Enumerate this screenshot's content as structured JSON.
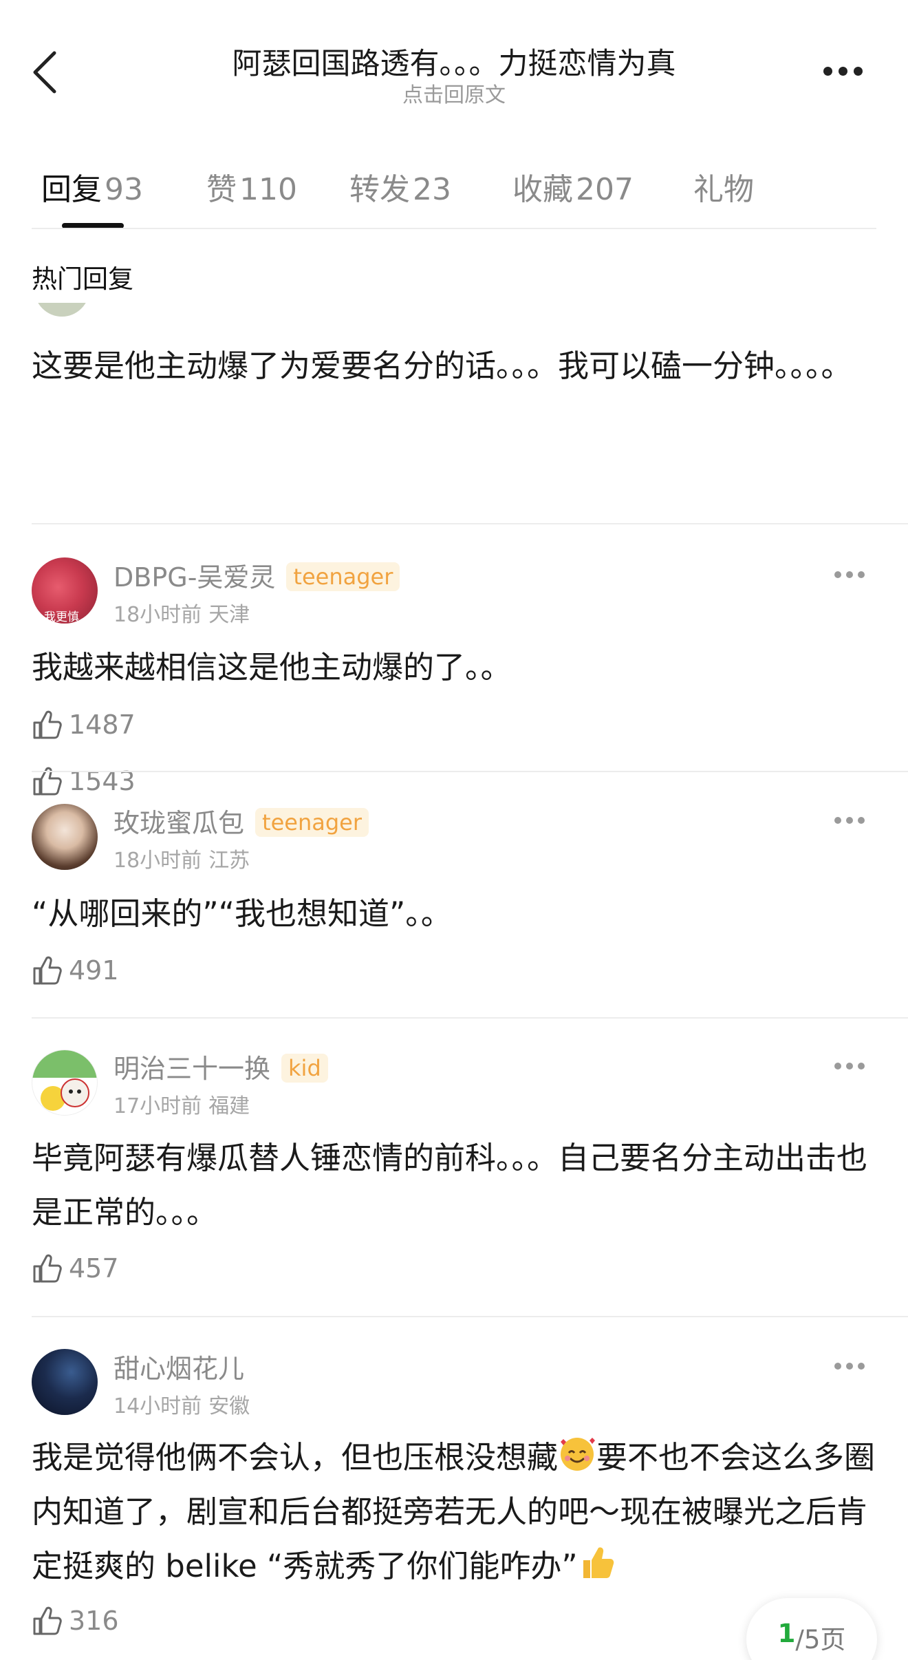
{
  "header": {
    "title": "阿瑟回国路透有。。。力挺恋情为真",
    "subtitle": "点击回原文"
  },
  "tabs": [
    {
      "label": "回复",
      "count": "93",
      "active": true
    },
    {
      "label": "赞",
      "count": "110",
      "active": false
    },
    {
      "label": "转发",
      "count": "23",
      "active": false
    },
    {
      "label": "收藏",
      "count": "207",
      "active": false
    },
    {
      "label": "礼物",
      "count": "",
      "active": false
    }
  ],
  "section_title": "热门回复",
  "comments": [
    {
      "partial": true,
      "text": "这要是他主动爆了为爱要名分的话。。。我可以磕一分钟。。。。",
      "likes": "1543"
    },
    {
      "username": "DBPG-吴爱灵",
      "badge": "teenager",
      "time": "18小时前",
      "location": "天津",
      "text": "我越来越相信这是他主动爆的了。。",
      "likes": "1487",
      "avatar_text": "我更慎"
    },
    {
      "username": "玫珑蜜瓜包",
      "badge": "teenager",
      "time": "18小时前",
      "location": "江苏",
      "text": "“从哪回来的”“我也想知道”。。",
      "likes": "491"
    },
    {
      "username": "明治三十一换",
      "badge": "kid",
      "time": "17小时前",
      "location": "福建",
      "text": "毕竟阿瑟有爆瓜替人锤恋情的前科。。。自己要名分主动出击也是正常的。。。",
      "likes": "457"
    },
    {
      "username": "甜心烟花儿",
      "badge": "",
      "time": "14小时前",
      "location": "安徽",
      "text_a": "我是觉得他俩不会认，但也压根没想藏",
      "text_b": "要不也不会这么多圈内知道了，剧宣和后台都挺旁若无人的吧～现在被曝光之后肯定挺爽的 belike “秀就秀了你们能咋办”",
      "likes": "316"
    }
  ],
  "pager": {
    "current": "1",
    "rest": "/5页"
  },
  "colors": {
    "badge_bg": "#fdf3df",
    "badge_text": "#f1a340",
    "pager_current": "#22aa3c",
    "divider": "#ececec"
  }
}
